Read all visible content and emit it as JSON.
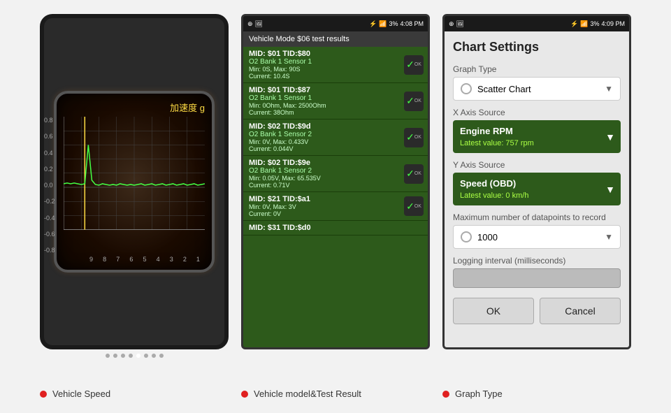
{
  "panels": [
    {
      "id": "panel1",
      "label": "Vehicle Speed",
      "chart": {
        "title": "加速度 g",
        "y_labels": [
          "0.8",
          "0.6",
          "0.4",
          "0.2",
          "0.0",
          "-0.2",
          "-0.4",
          "-0.6",
          "-0.8"
        ],
        "x_labels": [
          "9",
          "8",
          "7",
          "6",
          "5",
          "4",
          "3",
          "2",
          "1"
        ],
        "dots": [
          "",
          "",
          "",
          "",
          "active",
          "",
          "",
          ""
        ]
      }
    },
    {
      "id": "panel2",
      "label": "Vehicle model&Test Result",
      "status_bar": {
        "left": "●",
        "time": "4:08 PM",
        "battery": "3%"
      },
      "header": "Vehicle Mode $06 test results",
      "results": [
        {
          "mid": "MID: $01 TID:$80",
          "sensor": "O2 Bank 1 Sensor 1",
          "values": "Min: 0S, Max: 90S\nCurrent: 10.4S",
          "ok": true
        },
        {
          "mid": "MID: $01 TID:$87",
          "sensor": "O2 Bank 1 Sensor 1",
          "values": "Min: 0Ohm, Max: 2500Ohm\nCurrent: 38Ohm",
          "ok": true
        },
        {
          "mid": "MID: $02 TID:$9d",
          "sensor": "O2 Bank 1 Sensor 2",
          "values": "Min: 0V, Max: 0.433V\nCurrent: 0.044V",
          "ok": true
        },
        {
          "mid": "MID: $02 TID:$9e",
          "sensor": "O2 Bank 1 Sensor 2",
          "values": "Min: 0.05V, Max: 65.535V\nCurrent: 0.71V",
          "ok": true
        },
        {
          "mid": "MID: $21 TID:$a1",
          "sensor": "",
          "values": "Min: 0V, Max: 3V\nCurrent: 0V",
          "ok": true
        },
        {
          "mid": "MID: $31 TID:$d0",
          "sensor": "",
          "values": "",
          "ok": false
        }
      ]
    },
    {
      "id": "panel3",
      "label": "Graph Type",
      "status_bar": {
        "left": "●",
        "time": "4:09 PM",
        "battery": "3%"
      },
      "settings": {
        "title": "Chart Settings",
        "graph_type_label": "Graph Type",
        "graph_type_value": "Scatter Chart",
        "x_axis_label": "X Axis Source",
        "x_axis_value": "Engine RPM",
        "x_axis_sub": "Latest value: 757 rpm",
        "y_axis_label": "Y Axis Source",
        "y_axis_value": "Speed (OBD)",
        "y_axis_sub": "Latest value: 0 km/h",
        "max_datapoints_label": "Maximum number of datapoints to record",
        "max_datapoints_value": "1000",
        "logging_label": "Logging interval (milliseconds)",
        "ok_btn": "OK",
        "cancel_btn": "Cancel"
      }
    }
  ]
}
